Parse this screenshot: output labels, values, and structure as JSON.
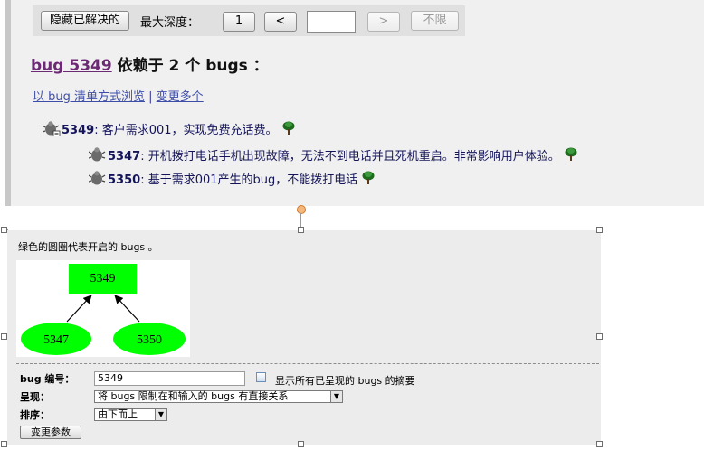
{
  "toolbar": {
    "hide_resolved_label": "隐藏已解决的",
    "max_depth_label": "最大深度：",
    "depth_one_label": "1",
    "depth_less_label": "<",
    "depth_value": "",
    "depth_greater_label": ">",
    "unlimited_label": "不限"
  },
  "heading": {
    "bug_link": "bug 5349",
    "text": " 依赖于 2 个 bugs ："
  },
  "view_links": {
    "list_view": "以 bug 清单方式浏览",
    "separator": " | ",
    "change_many": "变更多个"
  },
  "dependencies": {
    "root": {
      "number": "5349",
      "summary": ": 客户需求001，实现免费充话费。"
    },
    "children": [
      {
        "number": "5347",
        "summary": ": 开机拨打电话手机出现故障，无法不到电话并且死机重启。非常影响用户体验。"
      },
      {
        "number": "5350",
        "summary": ": 基于需求001产生的bug，不能拨打电话"
      }
    ]
  },
  "colors": {
    "open_bug_node": "#00ff00",
    "link_visited": "#6b2a73",
    "link": "#3e4ea8"
  },
  "graph": {
    "legend": "绿色的圆圈代表开启的 bugs 。",
    "nodes": {
      "root": "5349",
      "left": "5347",
      "right": "5350"
    }
  },
  "form": {
    "bug_id_label": "bug 编号：",
    "bug_id_value": "5349",
    "show_summaries_label": "显示所有已呈现的 bugs 的摘要",
    "display_label": "呈现：",
    "display_value": "将 bugs 限制在和输入的 bugs 有直接关系",
    "sort_label": "排序：",
    "sort_value": "由下而上",
    "change_params_label": "变更参数"
  },
  "icons": {
    "bug": "bug-icon",
    "tree": "tree-icon",
    "dropdown": "chevron-down-icon"
  }
}
